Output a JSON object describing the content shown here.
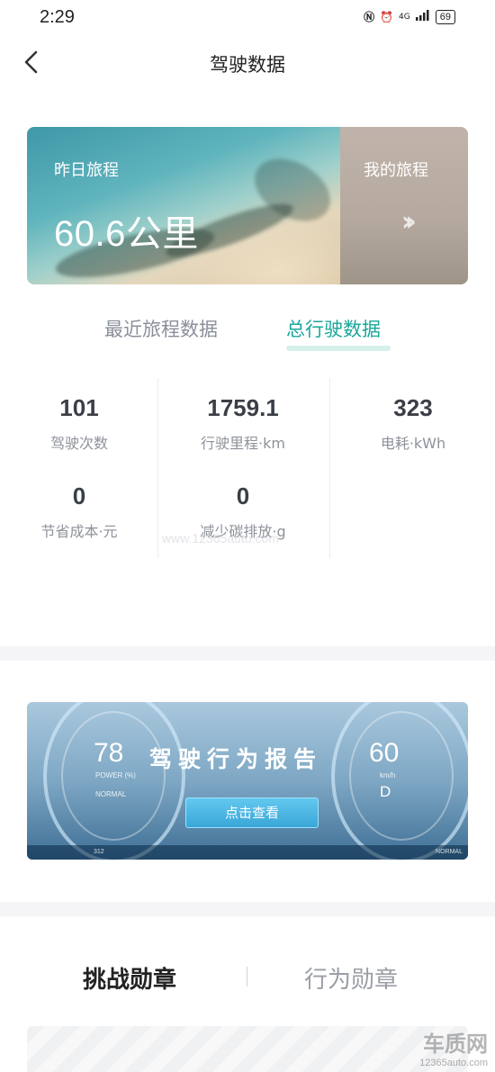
{
  "status_bar": {
    "time": "2:29",
    "battery": "69",
    "signal": "4G"
  },
  "header": {
    "title": "驾驶数据"
  },
  "trip_card": {
    "yesterday_label": "昨日旅程",
    "yesterday_value": "60.6公里",
    "my_trips_label": "我的旅程"
  },
  "tabs": {
    "recent": "最近旅程数据",
    "total": "总行驶数据",
    "active": "total"
  },
  "stats": [
    {
      "value": "101",
      "label": "驾驶次数"
    },
    {
      "value": "1759.1",
      "label": "行驶里程·km"
    },
    {
      "value": "323",
      "label": "电耗·kWh"
    },
    {
      "value": "0",
      "label": "节省成本·元"
    },
    {
      "value": "0",
      "label": "减少碳排放·g"
    }
  ],
  "watermark": "www.12365auto.com",
  "report_banner": {
    "title": "驾驶行为报告",
    "left_value": "78",
    "left_unit": "POWER (%)",
    "left_mode": "NORMAL",
    "right_value": "60",
    "right_unit": "km/h",
    "right_gear": "D",
    "button": "点击查看",
    "bottom_left": "312",
    "bottom_right": "NORMAL"
  },
  "badges": {
    "challenge": "挑战勋章",
    "behavior": "行为勋章"
  },
  "logo": {
    "name": "车质网",
    "url": "12365auto.com"
  }
}
